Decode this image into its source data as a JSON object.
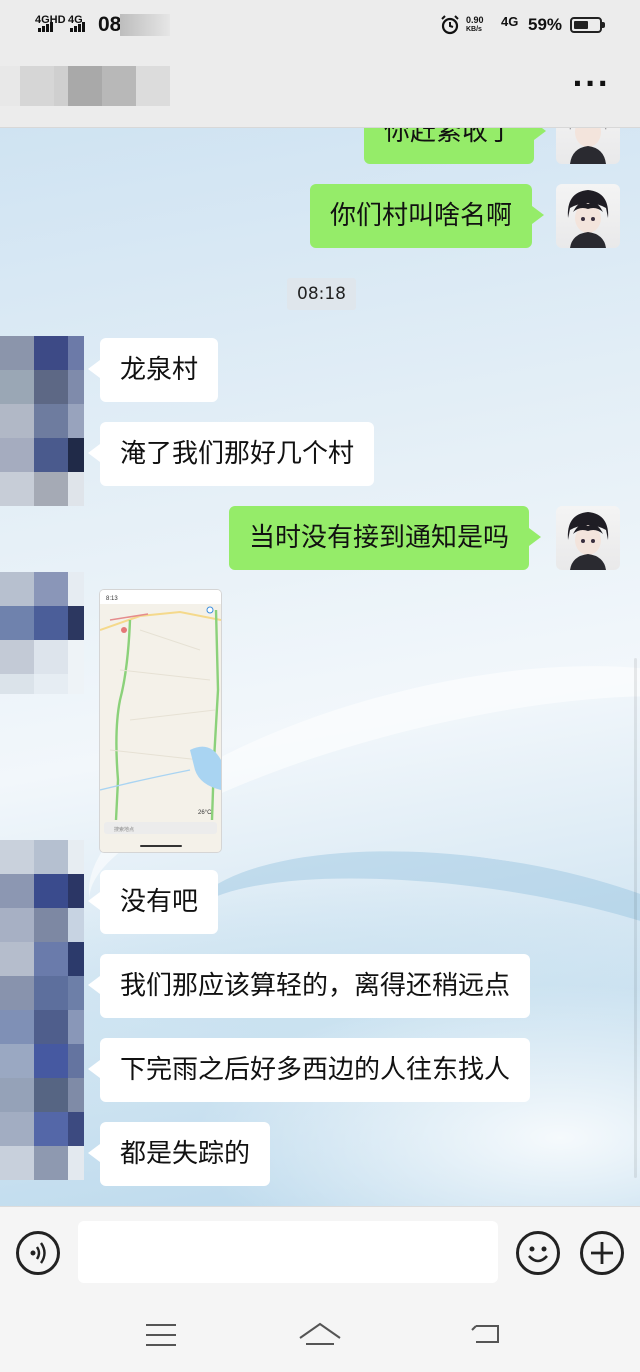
{
  "status_bar": {
    "network_1": "4GHD",
    "network_2": "4G",
    "time": "08:2",
    "speed_value": "0.90",
    "speed_unit": "KB/s",
    "network_3": "4G",
    "battery_percent": "59%",
    "battery_level": 0.59
  },
  "header": {
    "more_label": "···"
  },
  "messages": [
    {
      "from": "self",
      "text": "你赶紧收了"
    },
    {
      "from": "self",
      "text": "你们村叫啥名啊"
    },
    {
      "from": "other",
      "text": "龙泉村"
    },
    {
      "from": "other",
      "text": "淹了我们那好几个村"
    },
    {
      "from": "self",
      "text": "当时没有接到通知是吗"
    },
    {
      "from": "other",
      "type": "image",
      "text": ""
    },
    {
      "from": "other",
      "text": "没有吧"
    },
    {
      "from": "other",
      "text": "我们那应该算轻的，离得还稍远点"
    },
    {
      "from": "other",
      "text": "下完雨之后好多西边的人往东找人"
    },
    {
      "from": "other",
      "text": "都是失踪的"
    }
  ],
  "timestamp": "08:18",
  "map_image": {
    "time": "8:13",
    "temperature": "26°C",
    "search_placeholder": "搜索地点"
  },
  "input": {
    "value": "",
    "placeholder": ""
  },
  "colors": {
    "outgoing_bubble": "#95ec69",
    "incoming_bubble": "#ffffff"
  }
}
